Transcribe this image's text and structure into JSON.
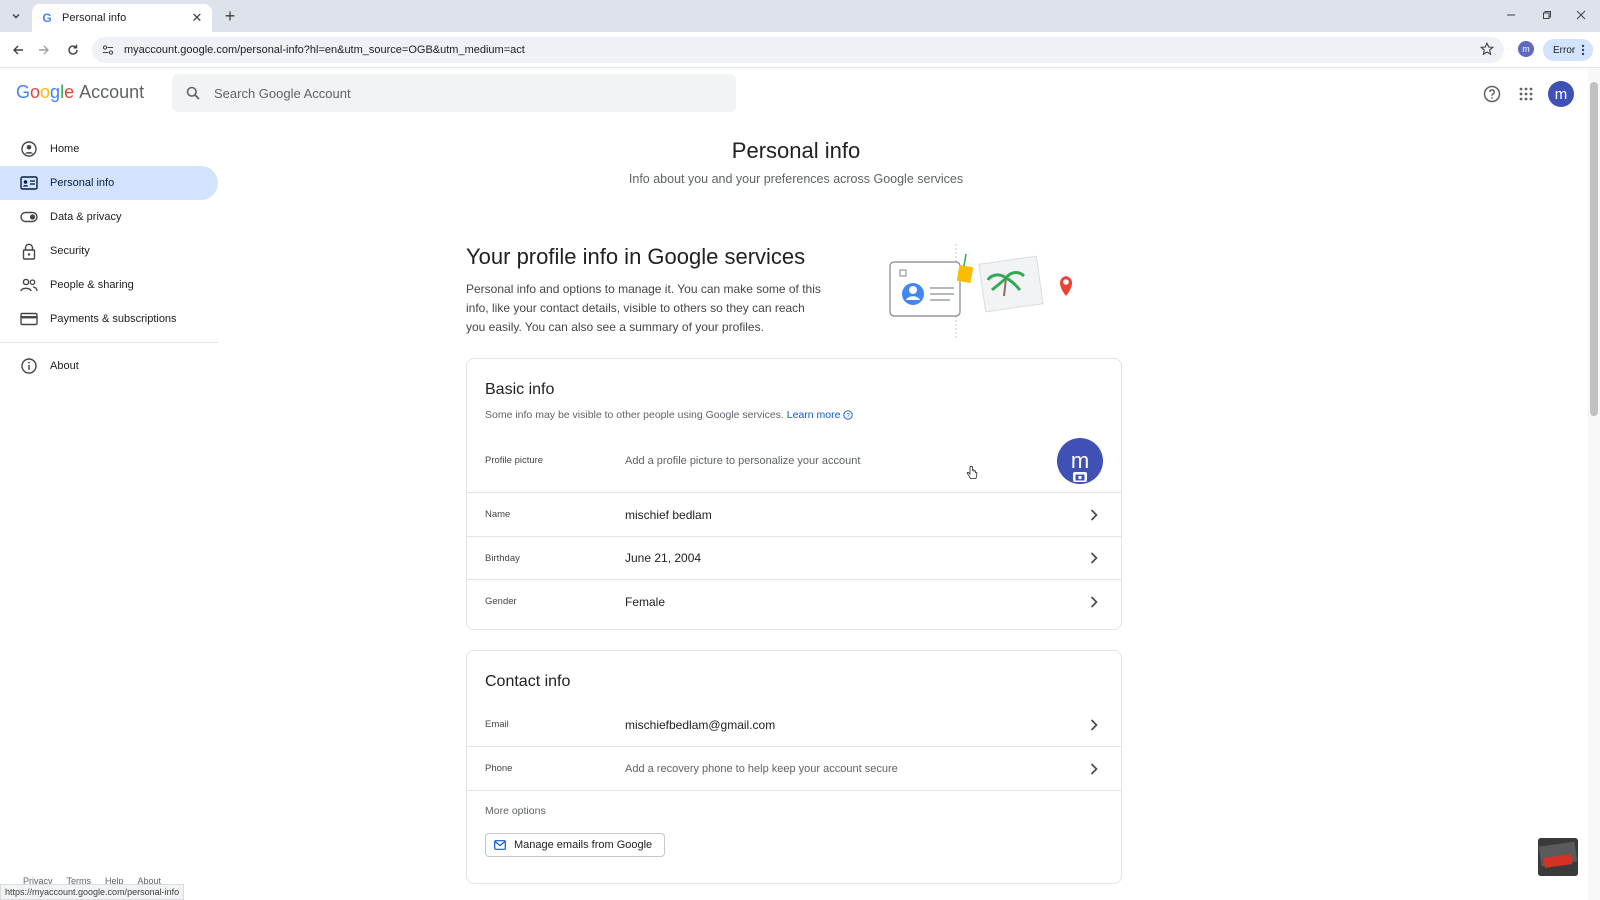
{
  "browser": {
    "tab_title": "Personal info",
    "url": "myaccount.google.com/personal-info?hl=en&utm_source=OGB&utm_medium=act",
    "profile_initial": "m",
    "error_label": "Error",
    "status_url": "https://myaccount.google.com/personal-info"
  },
  "header": {
    "logo_letters": [
      "G",
      "o",
      "o",
      "g",
      "l",
      "e"
    ],
    "logo_colors": [
      "#4285f4",
      "#ea4335",
      "#fbbc05",
      "#4285f4",
      "#34a853",
      "#ea4335"
    ],
    "logo_suffix": "Account",
    "search_placeholder": "Search Google Account",
    "avatar_initial": "m"
  },
  "sidebar": {
    "items": [
      {
        "label": "Home",
        "icon": "person-circle-icon"
      },
      {
        "label": "Personal info",
        "icon": "id-card-icon",
        "active": true
      },
      {
        "label": "Data & privacy",
        "icon": "toggle-icon"
      },
      {
        "label": "Security",
        "icon": "lock-icon"
      },
      {
        "label": "People & sharing",
        "icon": "people-icon"
      },
      {
        "label": "Payments & subscriptions",
        "icon": "credit-card-icon"
      },
      {
        "label": "About",
        "icon": "info-icon"
      }
    ],
    "footer": [
      "Privacy",
      "Terms",
      "Help",
      "About"
    ]
  },
  "main": {
    "title": "Personal info",
    "subtitle": "Info about you and your preferences across Google services",
    "intro_title": "Your profile info in Google services",
    "intro_text": "Personal info and options to manage it. You can make some of this info, like your contact details, visible to others so they can reach you easily. You can also see a summary of your profiles."
  },
  "basic_info": {
    "title": "Basic info",
    "desc": "Some info may be visible to other people using Google services.",
    "learn_more": "Learn more",
    "profile_picture": {
      "label": "Profile picture",
      "value": "Add a profile picture to personalize your account",
      "initial": "m"
    },
    "rows": [
      {
        "label": "Name",
        "value": "mischief bedlam"
      },
      {
        "label": "Birthday",
        "value": "June 21, 2004"
      },
      {
        "label": "Gender",
        "value": "Female"
      }
    ]
  },
  "contact_info": {
    "title": "Contact info",
    "rows": [
      {
        "label": "Email",
        "value": "mischiefbedlam@gmail.com"
      },
      {
        "label": "Phone",
        "value": "Add a recovery phone to help keep your account secure"
      }
    ],
    "more_options": "More options",
    "manage_button": "Manage emails from Google"
  },
  "colors": {
    "accent": "#0b57d0",
    "active_nav": "#d3e3fd",
    "avatar": "#3f51b5"
  }
}
